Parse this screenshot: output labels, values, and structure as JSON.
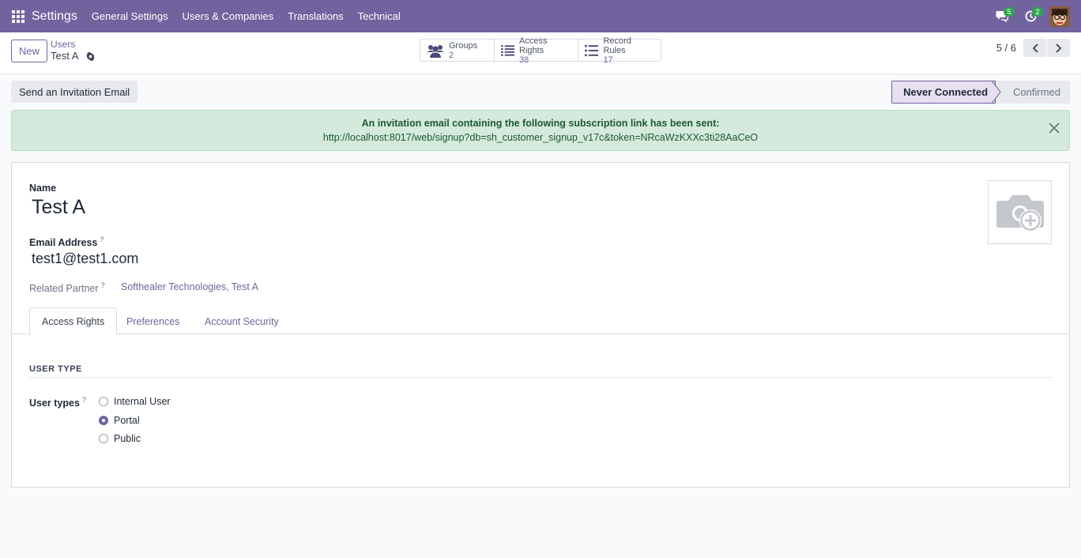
{
  "navbar": {
    "app_name": "Settings",
    "menu": [
      "General Settings",
      "Users & Companies",
      "Translations",
      "Technical"
    ],
    "messages_count": "5",
    "activities_count": "2"
  },
  "control": {
    "new_label": "New",
    "breadcrumb_parent": "Users",
    "breadcrumb_current": "Test A",
    "smart_buttons": [
      {
        "label": "Groups",
        "value": "2",
        "icon": "users-icon"
      },
      {
        "label": "Access Rights",
        "value": "38",
        "icon": "list-icon"
      },
      {
        "label": "Record Rules",
        "value": "17",
        "icon": "list-icon"
      }
    ],
    "pager": "5 / 6"
  },
  "header": {
    "invite_button": "Send an Invitation Email",
    "status_steps": [
      "Never Connected",
      "Confirmed"
    ],
    "active_status": "Never Connected"
  },
  "alert": {
    "title": "An invitation email containing the following subscription link has been sent:",
    "link": "http://localhost:8017/web/signup?db=sh_customer_signup_v17c&token=NRcaWzKXXc3ti28AaCeO"
  },
  "form": {
    "name_label": "Name",
    "name_value": "Test A",
    "email_label": "Email Address",
    "email_value": "test1@test1.com",
    "partner_label": "Related Partner",
    "partner_value": "Softhealer Technologies, Test A",
    "help_mark": "?",
    "tabs": [
      "Access Rights",
      "Preferences",
      "Account Security"
    ],
    "active_tab": "Access Rights",
    "section_title": "USER TYPE",
    "user_types_label": "User types",
    "user_types": [
      "Internal User",
      "Portal",
      "Public"
    ],
    "selected_user_type": "Portal"
  },
  "colors": {
    "brand": "#71639e",
    "alert_bg": "#d4eadc",
    "badge": "#2fa84f"
  }
}
